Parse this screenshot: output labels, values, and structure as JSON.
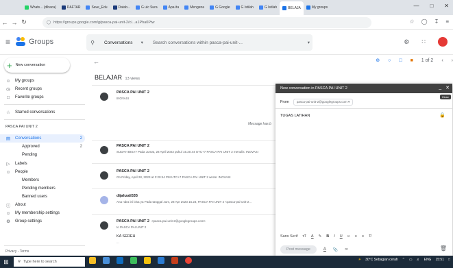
{
  "browser": {
    "tabs": [
      {
        "label": "Whats... (dibaca)",
        "color": "#25d366"
      },
      {
        "label": "DAFTAR",
        "color": "#1a3a7a"
      },
      {
        "label": "Save_Edu",
        "color": "#4285f4"
      },
      {
        "label": "Datab...",
        "color": "#1a3a7a"
      },
      {
        "label": "G ulc Sura",
        "color": "#4285f4"
      },
      {
        "label": "Apa itu",
        "color": "#4285f4"
      },
      {
        "label": "Mengena",
        "color": "#4285f4"
      },
      {
        "label": "G Google",
        "color": "#4285f4"
      },
      {
        "label": "G Istilah",
        "color": "#4285f4"
      },
      {
        "label": "G Istilah",
        "color": "#4285f4"
      },
      {
        "label": "BELAJA",
        "color": "#1a73e8"
      },
      {
        "label": "My groups",
        "color": "#1a73e8"
      }
    ],
    "active_tab_index": 10,
    "url": "https://groups.google.com/g/pasca-pai-unit-2/c/...a1Pha0Ptw"
  },
  "app": {
    "title": "Groups",
    "search_scope": "Conversations",
    "search_placeholder": "Search conversations within pasca-pai-unit-..."
  },
  "sidebar": {
    "new_conversation": "New conversation",
    "top_items": [
      {
        "label": "My groups",
        "icon": "people-icon"
      },
      {
        "label": "Recent groups",
        "icon": "clock-icon"
      },
      {
        "label": "Favorite groups",
        "icon": "folder-icon"
      }
    ],
    "starred": "Starred conversations",
    "group_name": "PASCA PAI UNIT 2",
    "conversations": {
      "label": "Conversations",
      "count": "2"
    },
    "approved": {
      "label": "Approved",
      "count": "2"
    },
    "pending": "Pending",
    "labels": "Labels",
    "people": "People",
    "members": "Members",
    "pending_members": "Pending members",
    "banned_users": "Banned users",
    "about": "About",
    "membership_settings": "My membership settings",
    "group_settings": "Group settings",
    "privacy": "Privacy - Terms"
  },
  "toolbar": {
    "page_info": "1 of 2"
  },
  "thread": {
    "title": "BELAJAR",
    "views": "13 views",
    "message_hint": "Message has b",
    "messages": [
      {
        "sender": "PASCA PAI UNIT 2",
        "address": "",
        "text": "INOVASI"
      },
      {
        "sender": "PASCA PAI UNIT 2",
        "address": "",
        "text": "SUDAH BISA? Pada Jumat, 28 April 2023 pukul 15.20.44 UTC+7 PASCA PAI UNIT 2 menulis: INOVASI"
      },
      {
        "sender": "PASCA PAI UNIT 2",
        "address": "",
        "text": "On Friday, April 28, 2023 at 3:20:44 PM UTC+7 PASCA PAI UNIT 2 wrote: INOVASI"
      },
      {
        "sender": "dijahzali535",
        "address": "",
        "text": "Ana ndra ini bisa ya Pada tanggal Jum, 28 Apr 2023 15.23, PASCA PAI UNIT 2 <pasca-pai-unit-2..."
      },
      {
        "sender": "PASCA PAI UNIT 2",
        "address": "<pasca-pai-unit-2@googlegroups.com>",
        "text": "to PASCA PAI UNIT 2"
      }
    ],
    "last_body": "KA SEREH",
    "last_more": "..."
  },
  "compose": {
    "header": "New conversation in PASCA PAI UNIT 2",
    "close_tip": "Close",
    "from_label": "From",
    "from_value": "pasca-pai-unit-2@googlegroups.com",
    "subject": "TUGAS LATIHAN",
    "font": "Sans Serif",
    "post_button": "Post message"
  },
  "taskbar": {
    "search_placeholder": "Type here to search",
    "weather": "30°C Sebagian cerah",
    "lang": "ENG",
    "time": "15:51"
  }
}
